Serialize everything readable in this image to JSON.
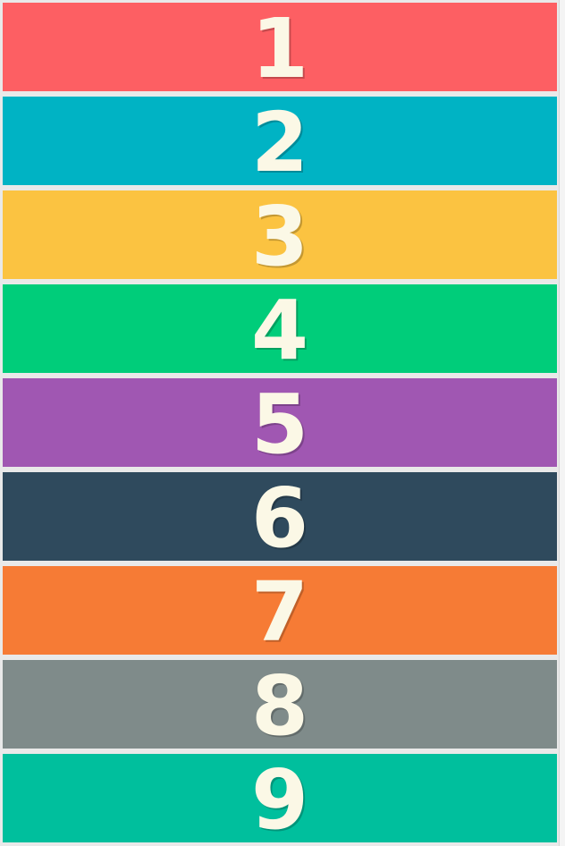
{
  "levels": [
    {
      "label": "1",
      "color": "#fd5f63"
    },
    {
      "label": "2",
      "color": "#00b3c4"
    },
    {
      "label": "3",
      "color": "#fbc341"
    },
    {
      "label": "4",
      "color": "#00cd7a"
    },
    {
      "label": "5",
      "color": "#a057b2"
    },
    {
      "label": "6",
      "color": "#2f4a5d"
    },
    {
      "label": "7",
      "color": "#f67b35"
    },
    {
      "label": "8",
      "color": "#7f8b8a"
    },
    {
      "label": "9",
      "color": "#00bf9d"
    }
  ]
}
